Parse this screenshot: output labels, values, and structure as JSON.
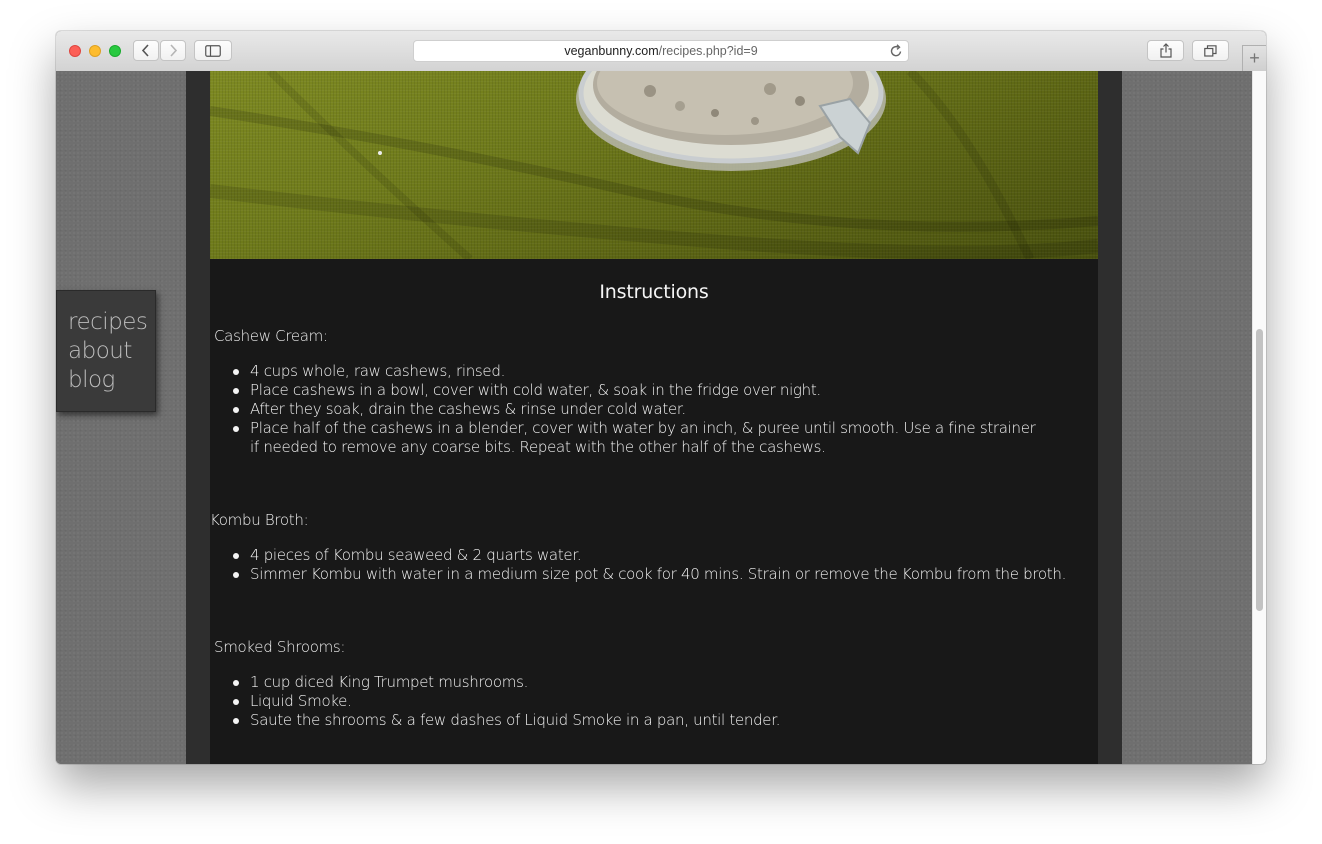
{
  "browser": {
    "url_domain": "veganbunny.com",
    "url_path": "/recipes.php?id=9",
    "new_tab_label": "+"
  },
  "nav": {
    "items": [
      {
        "label": "recipes"
      },
      {
        "label": "about"
      },
      {
        "label": "blog"
      }
    ]
  },
  "instructions": {
    "heading": "Instructions",
    "sections": [
      {
        "title": "Cashew Cream:",
        "steps": [
          "4 cups whole, raw cashews, rinsed.",
          "Place cashews in a bowl, cover with cold water, & soak in the fridge over night.",
          "After they soak, drain the cashews & rinse under cold water.",
          "Place half of the cashews in a blender, cover with water by an inch, & puree until smooth. Use a fine strainer if needed to remove any coarse bits. Repeat with the other half of the cashews."
        ]
      },
      {
        "title": "Kombu Broth:",
        "steps": [
          "4 pieces of Kombu seaweed & 2 quarts water.",
          "Simmer Kombu with water in a medium size pot & cook for 40 mins. Strain or remove the Kombu from the broth."
        ]
      },
      {
        "title": "Smoked Shrooms:",
        "steps": [
          "1 cup diced King Trumpet mushrooms.",
          "Liquid Smoke.",
          "Saute the shrooms & a few dashes of Liquid Smoke in a pan, until tender."
        ]
      }
    ]
  }
}
